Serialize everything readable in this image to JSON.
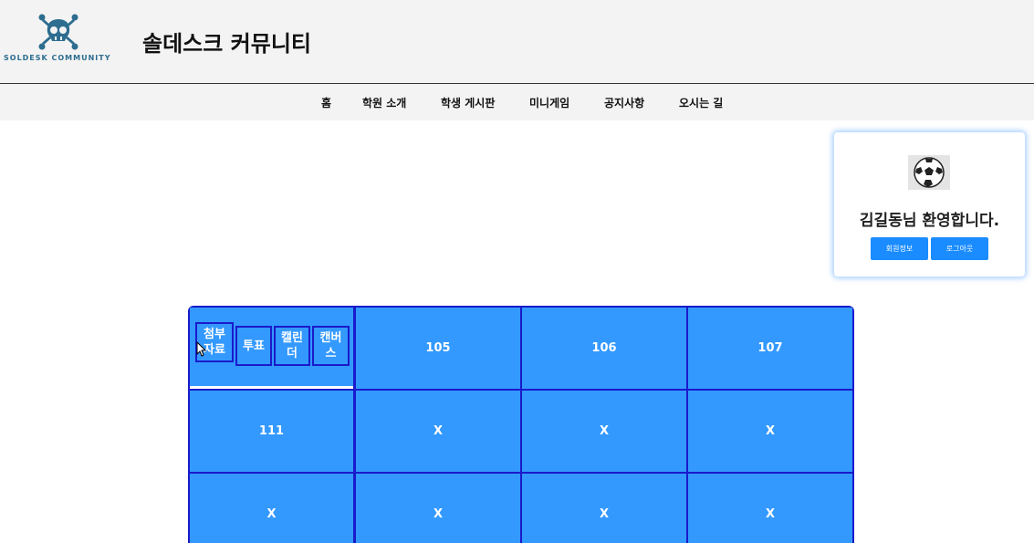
{
  "header": {
    "logo_text": "SOLDESK COMMUNITY",
    "title": "솔데스크 커뮤니티"
  },
  "nav": {
    "items": [
      "홈",
      "학원 소개",
      "학생 게시판",
      "미니게임",
      "공지사항",
      "오시는 길"
    ]
  },
  "welcome": {
    "avatar_icon": "soccer-ball-icon",
    "message": "김길동님 환영합니다.",
    "profile_button": "회원정보",
    "logout_button": "로그아웃"
  },
  "grid": {
    "first_cell_items": [
      "첨부\n자료",
      "투표",
      "캘린\n더",
      "캔버\n스"
    ],
    "row1": [
      "105",
      "106",
      "107"
    ],
    "row2": [
      "111",
      "X",
      "X",
      "X"
    ],
    "row3": [
      "X",
      "X",
      "X",
      "X"
    ]
  },
  "colors": {
    "cell_bg": "#3399ff",
    "cell_border": "#1a1acc",
    "button_bg": "#1a8cff"
  }
}
